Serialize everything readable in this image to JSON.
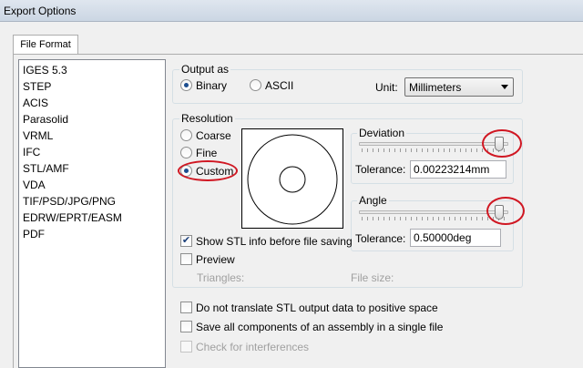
{
  "window": {
    "title": "Export Options"
  },
  "tabs": [
    {
      "label": "File Format"
    }
  ],
  "formats": [
    "IGES 5.3",
    "STEP",
    "ACIS",
    "Parasolid",
    "VRML",
    "IFC",
    "STL/AMF",
    "VDA",
    "TIF/PSD/JPG/PNG",
    "EDRW/EPRT/EASM",
    "PDF"
  ],
  "selected_format": "STL/AMF",
  "output": {
    "group_label": "Output as",
    "binary_label": "Binary",
    "ascii_label": "ASCII",
    "selected": "Binary",
    "unit_label": "Unit:",
    "unit_value": "Millimeters"
  },
  "resolution": {
    "group_label": "Resolution",
    "coarse_label": "Coarse",
    "fine_label": "Fine",
    "custom_label": "Custom",
    "selected": "Custom"
  },
  "deviation": {
    "group_label": "Deviation",
    "tolerance_label": "Tolerance:",
    "tolerance_value": "0.00223214mm",
    "slider_level": 1.0
  },
  "angle": {
    "group_label": "Angle",
    "tolerance_label": "Tolerance:",
    "tolerance_value": "0.50000deg",
    "slider_level": 1.0
  },
  "options": {
    "show_stl_info_label": "Show STL info before file saving",
    "show_stl_info_checked": true,
    "preview_label": "Preview",
    "preview_checked": false,
    "triangles_label": "Triangles:",
    "file_size_label": "File size:",
    "no_translate_label": "Do not translate STL output data to positive space",
    "no_translate_checked": false,
    "save_all_label": "Save all components of an assembly in a single file",
    "save_all_checked": false,
    "check_interferences_label": "Check for interferences",
    "check_interferences_checked": false
  },
  "colors": {
    "annotation": "#d01722",
    "selection_dot": "#1b4d8f",
    "titlebar": "#cbd6e3"
  },
  "icons": {
    "dropdown": "chevron-down-icon",
    "check": "checkmark-icon"
  }
}
